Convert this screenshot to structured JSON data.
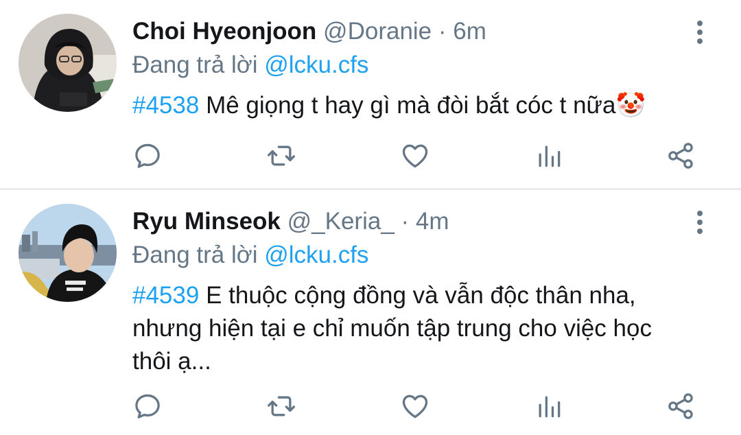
{
  "tweets": [
    {
      "name": "Choi Hyeonjoon",
      "handle": "@Doranie",
      "separator": "·",
      "time": "6m",
      "replying_prefix": "Đang trả lời",
      "replying_to": "@lcku.cfs",
      "hashtag": "#4538",
      "text_lines": [
        "Mê giọng t hay gì mà đòi bắt cóc t nữa"
      ],
      "emoji": "🤡",
      "avatar_icon": "user-avatar-hooded"
    },
    {
      "name": "Ryu Minseok",
      "handle": "@_Keria_",
      "separator": "·",
      "time": "4m",
      "replying_prefix": "Đang trả lời",
      "replying_to": "@lcku.cfs",
      "hashtag": "#4539",
      "text_lines": [
        "E thuộc cộng đồng và vẫn độc thân nha,",
        "nhưng hiện tại e chỉ muốn tập trung cho việc học",
        "thôi ạ..."
      ],
      "avatar_icon": "user-avatar-photo"
    }
  ],
  "actions": [
    "reply-icon",
    "retweet-icon",
    "like-icon",
    "stats-icon",
    "share-icon"
  ],
  "colors": {
    "accent": "#1da1f2",
    "secondary_text": "#657786",
    "primary_text": "#141619",
    "icon": "#657786",
    "divider": "#e9ecef"
  }
}
